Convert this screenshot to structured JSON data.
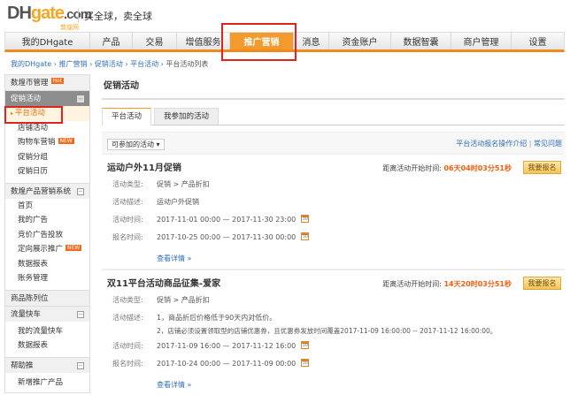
{
  "logo": {
    "text_dh": "DH",
    "text_gate": "gate",
    "text_com": ".com",
    "sub": "敦煌网"
  },
  "slogan": "买全球，卖全球",
  "nav": [
    {
      "label": "我的DHgate"
    },
    {
      "label": "产品"
    },
    {
      "label": "交易"
    },
    {
      "label": "增值服务"
    },
    {
      "label": "推广营销",
      "active": true
    },
    {
      "label": "消息"
    },
    {
      "label": "资金账户"
    },
    {
      "label": "数据智囊"
    },
    {
      "label": "商户管理"
    },
    {
      "label": "设置"
    }
  ],
  "breadcrumb": [
    "我的DHgate",
    "推广营销",
    "促销活动",
    "平台活动",
    "平台活动列表"
  ],
  "breadcrumb_sep": "›",
  "sidebar": {
    "hot": "Hot",
    "new": "NEW",
    "sections": [
      {
        "title": "数煌币管理",
        "badge": "Hot",
        "items": []
      },
      {
        "title": "促销活动",
        "items": [
          "平台活动",
          "店铺活动",
          "购物车营销",
          "促销分组",
          "促销日历"
        ]
      },
      {
        "title": "数煌产品营销系统",
        "items": [
          "首页",
          "我的广告",
          "竞价广告投放",
          "定向展示推广",
          "数据报表",
          "账务管理"
        ]
      },
      {
        "title": "商品陈列位",
        "items": []
      },
      {
        "title": "流量快车",
        "items": [
          "我的流量快车",
          "数据报表"
        ]
      },
      {
        "title": "帮助推",
        "items": [
          "新增推广产品"
        ]
      }
    ]
  },
  "main": {
    "title": "促销活动",
    "tabs": [
      "平台活动",
      "我参加的活动"
    ],
    "filter": {
      "selected": "可参加的活动"
    },
    "links": [
      "平台活动报名操作介绍",
      "常见问题"
    ],
    "labels": {
      "type": "活动类型:",
      "desc": "活动描述:",
      "time": "活动时间:",
      "signup_time": "报名时间:",
      "countdown": "距离活动开始时间:",
      "signup_btn": "我要报名",
      "more": "查看详情 »",
      "cal": "30"
    },
    "activities": [
      {
        "title": "运动户外11月促销",
        "countdown": "06天04时03分51秒",
        "type": "促销 > 产品折扣",
        "desc": [
          "运动户外促销"
        ],
        "time": "2017-11-01 00:00 — 2017-11-30 23:00",
        "signup_time": "2017-10-25 00:00 — 2017-11-30 00:00"
      },
      {
        "title": "双11平台活动商品征集-爱家",
        "countdown": "14天20时03分51秒",
        "type": "促销 > 产品折扣",
        "desc": [
          "1，商品折后价格低于90天内对低价。",
          "2，店铺必须设置领取型的店铺优惠券，且优惠券发放时间覆盖2017-11-09 16:00:00 -- 2017-11-12 16:00:00。"
        ],
        "time": "2017-11-09 16:00 — 2017-11-12 16:00",
        "signup_time": "2017-10-24 00:00 — 2017-11-09 00:00"
      }
    ]
  },
  "colors": {
    "accent": "#f39a2c",
    "link": "#2f6fb8",
    "countdown": "#f55c0d",
    "highlight": "#e0231b"
  }
}
